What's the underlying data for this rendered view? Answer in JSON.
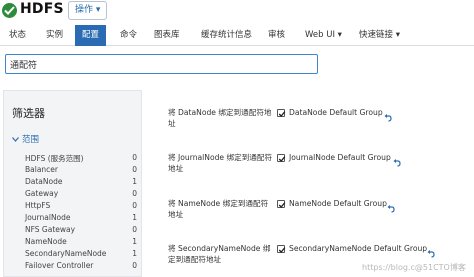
{
  "header": {
    "app_title": "HDFS",
    "actions_label": "操作 ▾"
  },
  "tabs": [
    {
      "label": "状态"
    },
    {
      "label": "实例"
    },
    {
      "label": "配置"
    },
    {
      "label": "命令"
    },
    {
      "label": "图表库"
    },
    {
      "label": "缓存统计信息"
    },
    {
      "label": "审核"
    },
    {
      "label": "Web UI ▾"
    },
    {
      "label": "快速链接 ▾"
    }
  ],
  "search": {
    "value": "通配符"
  },
  "filters": {
    "title": "筛选器",
    "scope_label": "范围",
    "items": [
      {
        "name": "HDFS (服务范围)",
        "count": "0"
      },
      {
        "name": "Balancer",
        "count": "0"
      },
      {
        "name": "DataNode",
        "count": "1"
      },
      {
        "name": "Gateway",
        "count": "0"
      },
      {
        "name": "HttpFS",
        "count": "0"
      },
      {
        "name": "JournalNode",
        "count": "1"
      },
      {
        "name": "NFS Gateway",
        "count": "0"
      },
      {
        "name": "NameNode",
        "count": "1"
      },
      {
        "name": "SecondaryNameNode",
        "count": "1"
      },
      {
        "name": "Failover Controller",
        "count": "0"
      }
    ]
  },
  "settings": [
    {
      "label": "将 DataNode 绑定到通配符地址",
      "group": "DataNode Default Group",
      "checked": true
    },
    {
      "label": "将 JournalNode 绑定到通配符地址",
      "group": "JournalNode Default Group",
      "checked": true
    },
    {
      "label": "将 NameNode 绑定到通配符地址",
      "group": "NameNode Default Group",
      "checked": true
    },
    {
      "label": "将 SecondaryNameNode 绑定到通配符地址",
      "group": "SecondaryNameNode Default Group",
      "checked": true
    }
  ],
  "watermark": "https://blog.c@51CTO博客",
  "colors": {
    "accent": "#2a6bb3",
    "logo": "#2e8b3d"
  }
}
